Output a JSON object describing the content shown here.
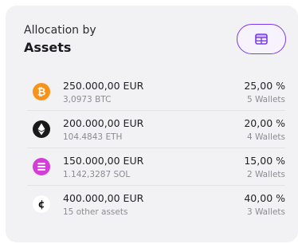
{
  "card": {
    "title_line1": "Allocation by",
    "title_line2": "Assets"
  },
  "view_toggle": {
    "icon": "table-icon",
    "color": "#7c3aed"
  },
  "assets": [
    {
      "icon": "bitcoin-icon",
      "icon_color": "#f7931a",
      "amount": "250.000,00 EUR",
      "quantity": "3,0973 BTC",
      "percent": "25,00 %",
      "wallets": "5 Wallets"
    },
    {
      "icon": "ethereum-icon",
      "icon_color": "#1a1a1a",
      "amount": "200.000,00 EUR",
      "quantity": "104.4843 ETH",
      "percent": "20,00 %",
      "wallets": "4 Wallets"
    },
    {
      "icon": "solana-icon",
      "icon_color": "#d43dd8",
      "amount": "150.000,00 EUR",
      "quantity": "1.142,3287 SOL",
      "percent": "15,00 %",
      "wallets": "2 Wallets"
    },
    {
      "icon": "other-assets-icon",
      "icon_color": "#ffffff",
      "amount": "400.000,00 EUR",
      "quantity": "15 other assets",
      "percent": "40,00 %",
      "wallets": "3 Wallets"
    }
  ]
}
